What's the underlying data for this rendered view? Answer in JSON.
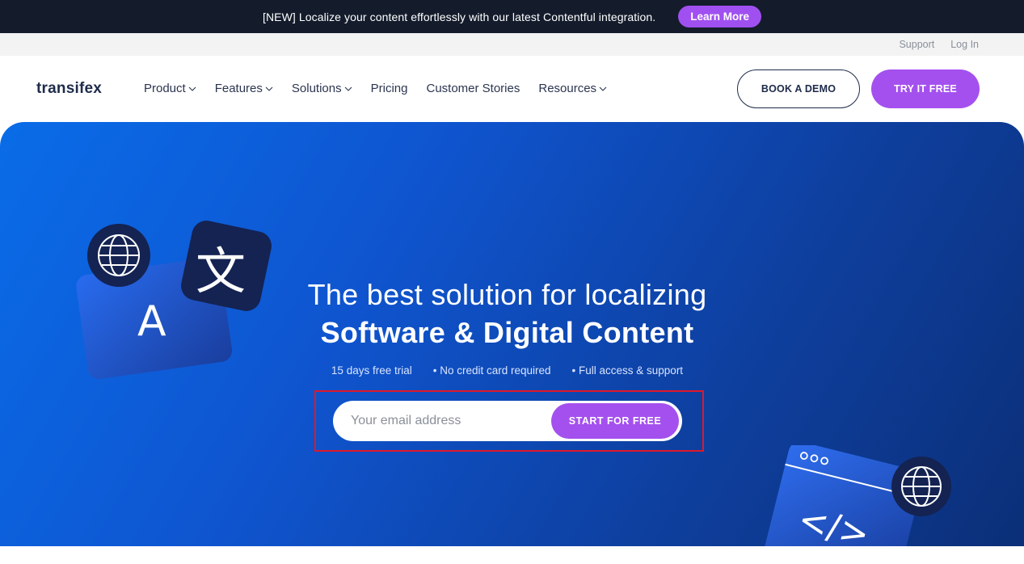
{
  "announcement": {
    "text": "[NEW] Localize your content effortlessly with our latest Contentful integration.",
    "cta": "Learn More"
  },
  "utility": {
    "support": "Support",
    "login": "Log In"
  },
  "nav": {
    "logo": "transifex",
    "items": [
      {
        "label": "Product",
        "dropdown": true
      },
      {
        "label": "Features",
        "dropdown": true
      },
      {
        "label": "Solutions",
        "dropdown": true
      },
      {
        "label": "Pricing",
        "dropdown": false
      },
      {
        "label": "Customer Stories",
        "dropdown": false
      },
      {
        "label": "Resources",
        "dropdown": true
      }
    ],
    "book_demo": "BOOK A DEMO",
    "try_free": "TRY IT FREE"
  },
  "hero": {
    "line1": "The best solution for localizing",
    "line2": "Software & Digital Content",
    "features": [
      "15 days free trial",
      "• No credit card required",
      "• Full access & support"
    ],
    "email_placeholder": "Your email address",
    "start_button": "START FOR FREE"
  },
  "icons": {
    "globe": "globe-icon",
    "translate_letter": "A",
    "translate_char": "文",
    "code": "</>"
  },
  "colors": {
    "accent": "#a450ee",
    "topbar": "#141c2c",
    "hero_start": "#0a6ce8",
    "hero_end": "#0b2f78",
    "dark_text": "#1e2b4a"
  }
}
